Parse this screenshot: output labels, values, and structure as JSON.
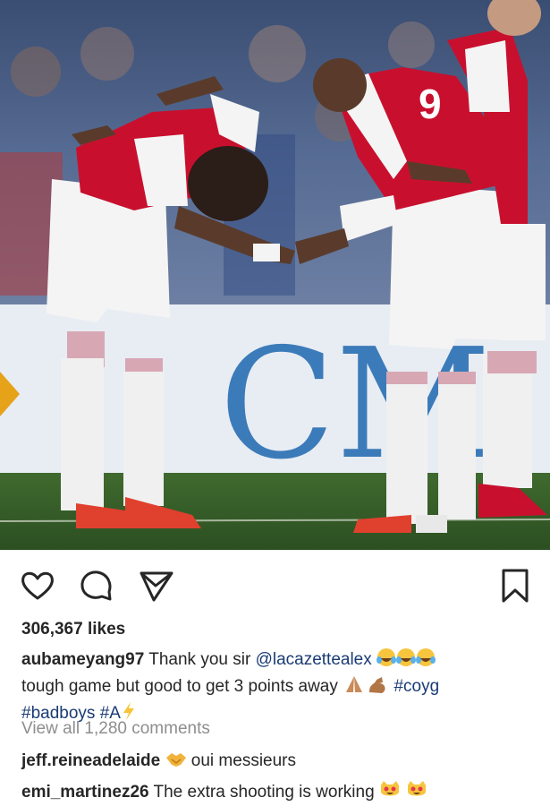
{
  "post": {
    "likes_text": "306,367 likes",
    "author": "aubameyang97",
    "caption_text_1": " Thank you sir ",
    "mention": "@lacazettealex",
    "caption_text_2": "tough game but good to get 3 points away ",
    "hashtag_coyg": "#coyg",
    "hashtag_badboys": "#badboys",
    "hashtag_a": "#A",
    "view_all_comments": "View all 1,280 comments"
  },
  "comments": [
    {
      "user": "jeff.reineadelaide",
      "text": " oui messieurs"
    },
    {
      "user": "emi_martinez26",
      "text": " The extra shooting is working "
    }
  ],
  "image": {
    "banner_text": "CM",
    "jersey_number": "9"
  },
  "icons": {
    "like": "heart-icon",
    "comment": "speech-bubble-icon",
    "share": "paper-plane-icon",
    "save": "bookmark-icon"
  },
  "colors": {
    "link": "#1a3b74",
    "muted": "#8e8e8e",
    "text": "#262626",
    "jersey_red": "#c8102e"
  }
}
